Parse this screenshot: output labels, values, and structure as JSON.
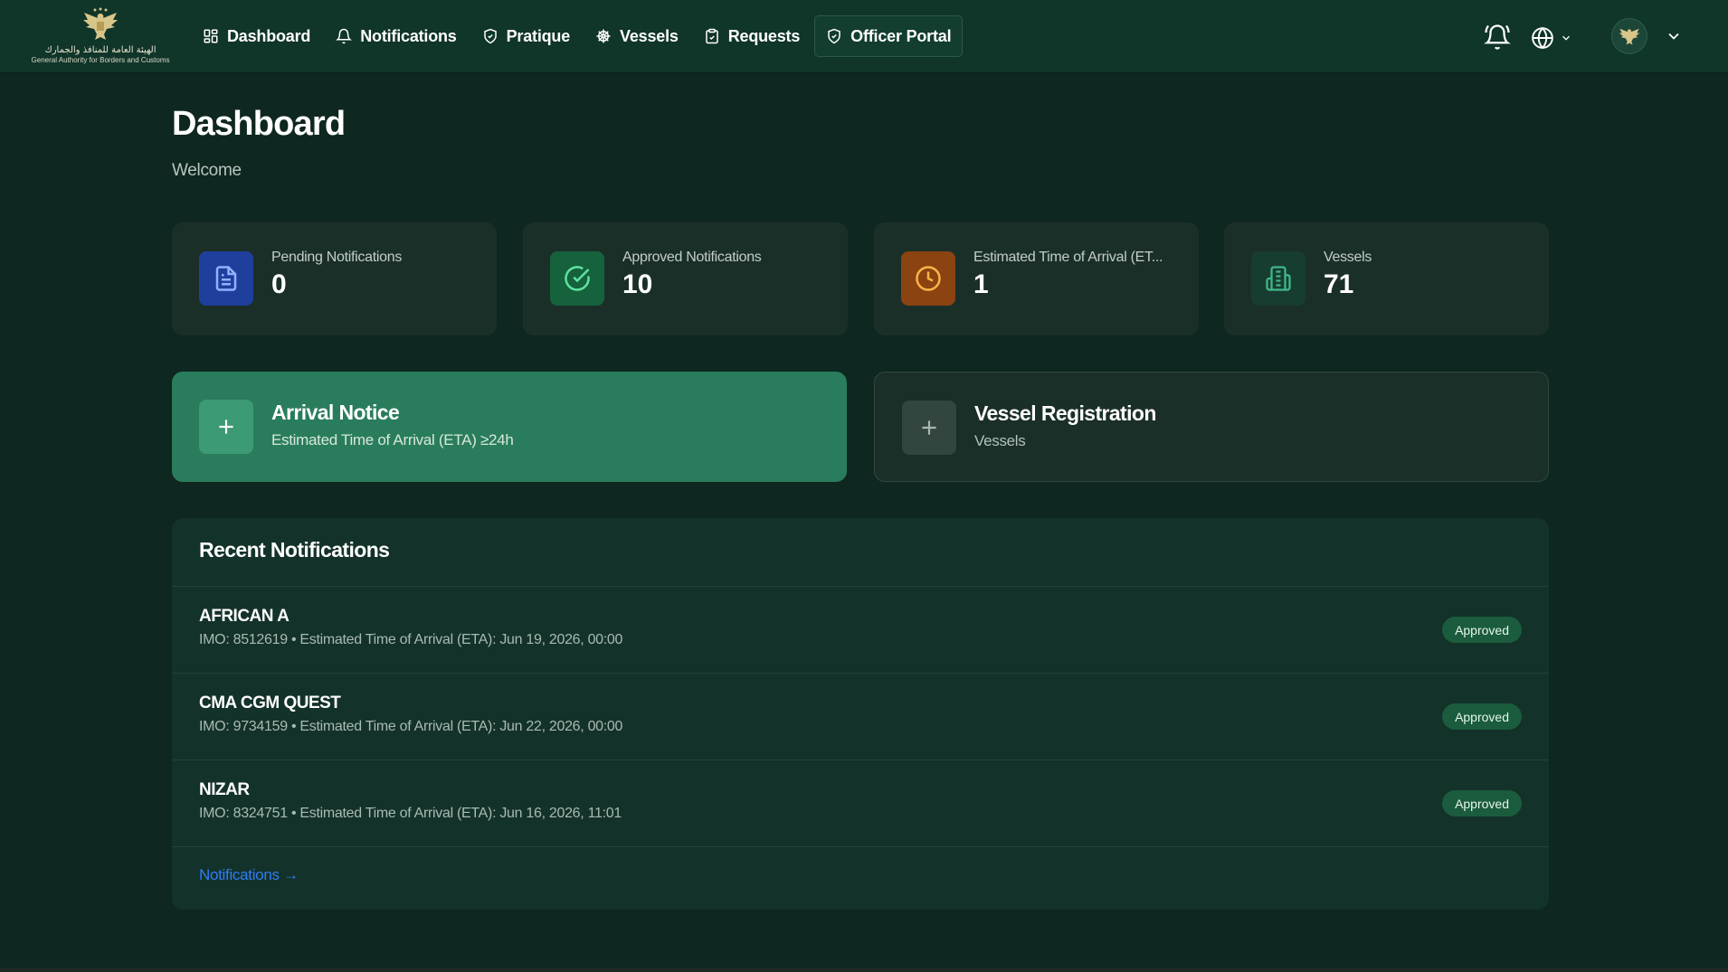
{
  "brand": {
    "arabic_name": "الهيئة العامة للمنافذ والجمارك",
    "english_name": "General Authority for Borders and Customs"
  },
  "nav": {
    "items": [
      {
        "label": "Dashboard",
        "icon": "grid-icon"
      },
      {
        "label": "Notifications",
        "icon": "bell-icon"
      },
      {
        "label": "Pratique",
        "icon": "shield-check-icon"
      },
      {
        "label": "Vessels",
        "icon": "ship-wheel-icon"
      },
      {
        "label": "Requests",
        "icon": "clipboard-check-icon"
      },
      {
        "label": "Officer Portal",
        "icon": "shield-check-icon",
        "active": true
      }
    ]
  },
  "page": {
    "title": "Dashboard",
    "subtitle": "Welcome"
  },
  "stats": [
    {
      "label": "Pending Notifications",
      "value": "0",
      "icon": "document-icon",
      "color": "#1f3f9c"
    },
    {
      "label": "Approved Notifications",
      "value": "10",
      "icon": "check-circle-icon",
      "color": "#16623c"
    },
    {
      "label": "Estimated Time of Arrival (ET...",
      "value": "1",
      "icon": "clock-icon",
      "color": "#8a4311"
    },
    {
      "label": "Vessels",
      "value": "71",
      "icon": "building-icon",
      "color": "#173c30"
    }
  ],
  "actions": {
    "arrival": {
      "title": "Arrival Notice",
      "subtitle": "Estimated Time of Arrival (ETA) ≥24h"
    },
    "vessel": {
      "title": "Vessel Registration",
      "subtitle": "Vessels"
    }
  },
  "recent": {
    "title": "Recent Notifications",
    "rows": [
      {
        "name": "AFRICAN A",
        "meta": "IMO: 8512619 • Estimated Time of Arrival (ETA): Jun 19, 2026, 00:00",
        "status": "Approved"
      },
      {
        "name": "CMA CGM QUEST",
        "meta": "IMO: 9734159 • Estimated Time of Arrival (ETA): Jun 22, 2026, 00:00",
        "status": "Approved"
      },
      {
        "name": "NIZAR",
        "meta": "IMO: 8324751 • Estimated Time of Arrival (ETA): Jun 16, 2026, 11:01",
        "status": "Approved"
      }
    ],
    "see_all": "Notifications →"
  },
  "colors": {
    "background": "#0e2720",
    "header": "#103529",
    "accent": "#2a7d5c",
    "link": "#2f7cf6",
    "badge": "#1a5c3d"
  }
}
